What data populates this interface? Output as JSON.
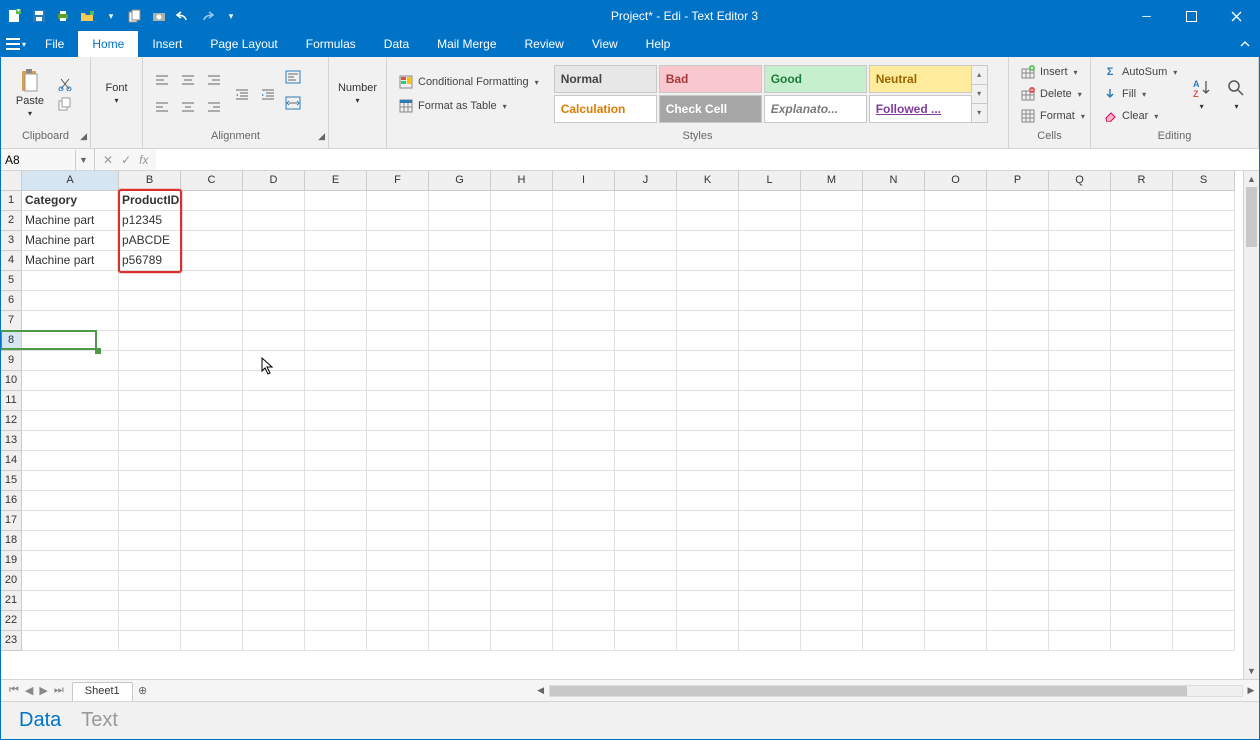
{
  "title": "Project* - Edi - Text Editor 3",
  "tabs": [
    "File",
    "Home",
    "Insert",
    "Page Layout",
    "Formulas",
    "Data",
    "Mail Merge",
    "Review",
    "View",
    "Help"
  ],
  "activeTab": "Home",
  "ribbon": {
    "clipboard": {
      "label": "Clipboard",
      "paste": "Paste"
    },
    "font": {
      "label": "Font",
      "btn": "Font"
    },
    "alignment": {
      "label": "Alignment"
    },
    "number": {
      "label": "Number",
      "btn": "Number"
    },
    "cond_fmt": "Conditional Formatting",
    "fmt_table": "Format as Table",
    "styles": {
      "label": "Styles",
      "cells": [
        {
          "t": "Normal",
          "bg": "#e7e7e7",
          "fg": "#444"
        },
        {
          "t": "Bad",
          "bg": "#f9c7ce",
          "fg": "#a6373a"
        },
        {
          "t": "Good",
          "bg": "#c6efce",
          "fg": "#1e7b3b"
        },
        {
          "t": "Neutral",
          "bg": "#ffeb9c",
          "fg": "#9b6500"
        },
        {
          "t": "Calculation",
          "bg": "#ffffff",
          "fg": "#e07c00",
          "b": true
        },
        {
          "t": "Check Cell",
          "bg": "#a6a6a6",
          "fg": "#ffffff",
          "b": true
        },
        {
          "t": "Explanato...",
          "bg": "#ffffff",
          "fg": "#7a7a7a",
          "i": true
        },
        {
          "t": "Followed ...",
          "bg": "#ffffff",
          "fg": "#7d3c98",
          "u": true,
          "b": true
        }
      ]
    },
    "cells": {
      "label": "Cells",
      "insert": "Insert",
      "delete": "Delete",
      "format": "Format"
    },
    "editing": {
      "label": "Editing",
      "autosum": "AutoSum",
      "fill": "Fill",
      "clear": "Clear"
    }
  },
  "namebox": "A8",
  "columns": [
    "A",
    "B",
    "C",
    "D",
    "E",
    "F",
    "G",
    "H",
    "I",
    "J",
    "K",
    "L",
    "M",
    "N",
    "O",
    "P",
    "Q",
    "R",
    "S"
  ],
  "activeCol": "A",
  "rows": 23,
  "activeRow": 8,
  "data": {
    "1": {
      "A": "Category",
      "B": "ProductID"
    },
    "2": {
      "A": "Machine part",
      "B": "p12345"
    },
    "3": {
      "A": "Machine part",
      "B": "pABCDE"
    },
    "4": {
      "A": "Machine part",
      "B": "p56789"
    }
  },
  "boldCells": [
    "1A",
    "1B"
  ],
  "sheet": "Sheet1",
  "bottomTabs": [
    "Data",
    "Text"
  ],
  "bottomActive": "Data"
}
